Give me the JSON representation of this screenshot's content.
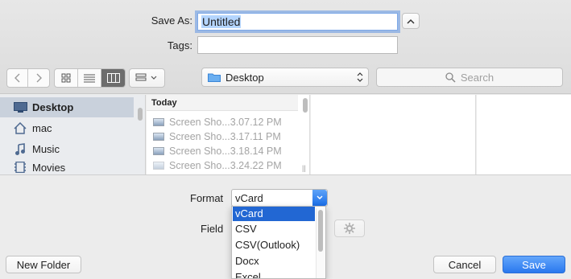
{
  "save_as": {
    "label": "Save As:",
    "value": "Untitled"
  },
  "tags": {
    "label": "Tags:",
    "value": ""
  },
  "location": {
    "value": "Desktop"
  },
  "search": {
    "placeholder": "Search"
  },
  "sidebar": {
    "items": [
      {
        "label": "Desktop",
        "icon": "desktop-icon",
        "selected": true
      },
      {
        "label": "mac",
        "icon": "home-icon"
      },
      {
        "label": "Music",
        "icon": "music-note-icon"
      },
      {
        "label": "Movies",
        "icon": "film-icon"
      }
    ]
  },
  "file_list": {
    "group_header": "Today",
    "files": [
      {
        "name": "Screen Sho...3.07.12 PM"
      },
      {
        "name": "Screen Sho...3.17.11 PM"
      },
      {
        "name": "Screen Sho...3.18.14 PM"
      },
      {
        "name": "Screen Sho...3.24.22 PM"
      }
    ]
  },
  "format": {
    "label": "Format",
    "selected": "vCard",
    "options": [
      "vCard",
      "CSV",
      "CSV(Outlook)",
      "Docx",
      "Excel"
    ]
  },
  "field": {
    "label": "Field"
  },
  "buttons": {
    "new_folder": "New Folder",
    "cancel": "Cancel",
    "save": "Save"
  },
  "colors": {
    "accent": "#2267d3",
    "save_button": "#3b82f0",
    "selection": "#b4d5fe"
  }
}
